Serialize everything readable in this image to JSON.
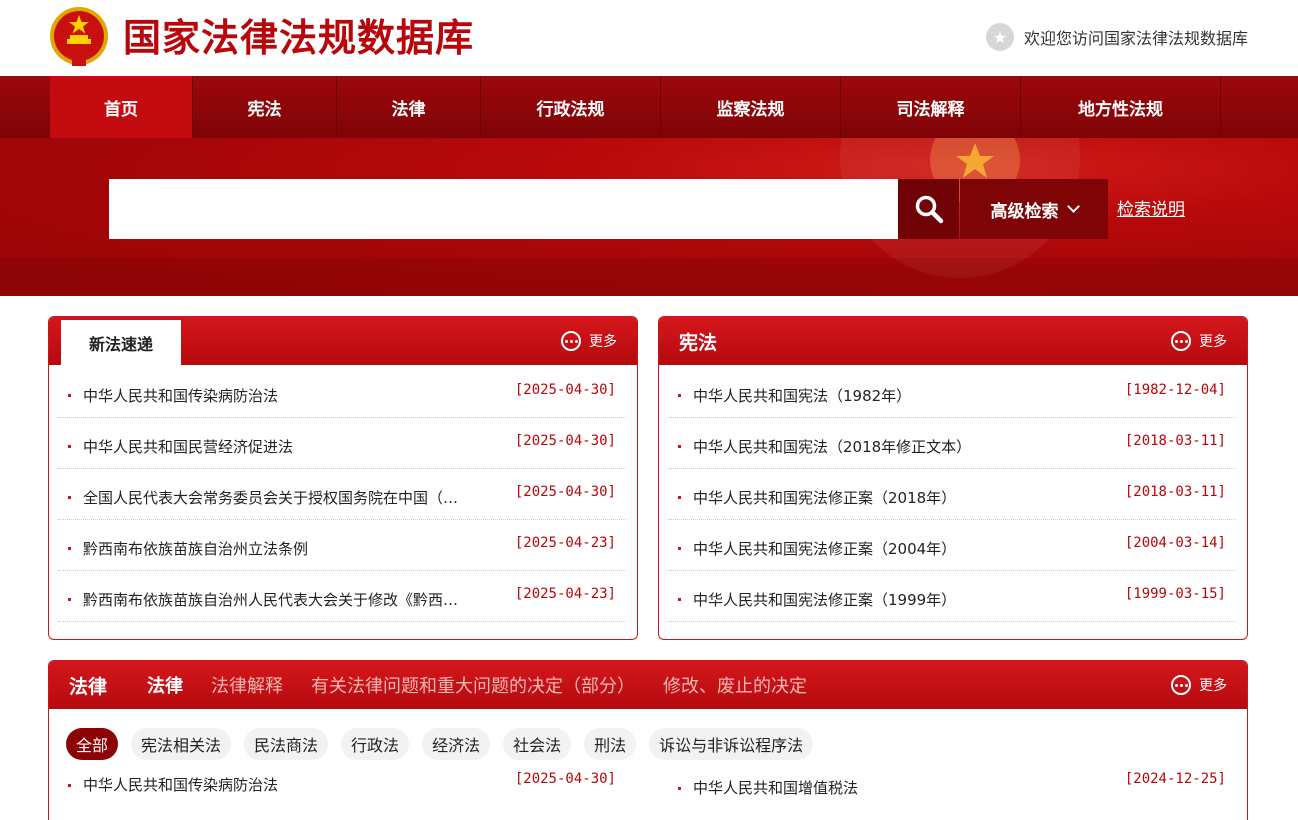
{
  "header": {
    "site_title": "国家法律法规数据库",
    "welcome": "欢迎您访问国家法律法规数据库",
    "star_icon": "star-icon",
    "emblem_icon": "national-emblem-icon"
  },
  "nav": {
    "items": [
      {
        "label": "首页",
        "active": true
      },
      {
        "label": "宪法"
      },
      {
        "label": "法律"
      },
      {
        "label": "行政法规"
      },
      {
        "label": "监察法规"
      },
      {
        "label": "司法解释"
      },
      {
        "label": "地方性法规"
      }
    ]
  },
  "search": {
    "placeholder": "",
    "search_icon": "search-icon",
    "advanced_label": "高级检索",
    "help_label": "检索说明"
  },
  "new_laws": {
    "tab": "新法速递",
    "more": "更多",
    "items": [
      {
        "title": "中华人民共和国传染病防治法",
        "date": "[2025-04-30]"
      },
      {
        "title": "中华人民共和国民营经济促进法",
        "date": "[2025-04-30]"
      },
      {
        "title": "全国人民代表大会常务委员会关于授权国务院在中国（…",
        "date": "[2025-04-30]"
      },
      {
        "title": "黔西南布依族苗族自治州立法条例",
        "date": "[2025-04-23]"
      },
      {
        "title": "黔西南布依族苗族自治州人民代表大会关于修改《黔西…",
        "date": "[2025-04-23]"
      }
    ]
  },
  "constitution": {
    "title": "宪法",
    "more": "更多",
    "items": [
      {
        "title": "中华人民共和国宪法（1982年）",
        "date": "[1982-12-04]"
      },
      {
        "title": "中华人民共和国宪法（2018年修正文本）",
        "date": "[2018-03-11]"
      },
      {
        "title": "中华人民共和国宪法修正案（2018年）",
        "date": "[2018-03-11]"
      },
      {
        "title": "中华人民共和国宪法修正案（2004年）",
        "date": "[2004-03-14]"
      },
      {
        "title": "中华人民共和国宪法修正案（1999年）",
        "date": "[1999-03-15]"
      }
    ]
  },
  "laws": {
    "title": "法律",
    "more": "更多",
    "tabs": [
      {
        "label": "法律",
        "active": true
      },
      {
        "label": "法律解释"
      },
      {
        "label": "有关法律问题和重大问题的决定（部分）"
      },
      {
        "label": "修改、废止的决定"
      }
    ],
    "chips": [
      {
        "label": "全部",
        "active": true
      },
      {
        "label": "宪法相关法"
      },
      {
        "label": "民法商法"
      },
      {
        "label": "行政法"
      },
      {
        "label": "经济法"
      },
      {
        "label": "社会法"
      },
      {
        "label": "刑法"
      },
      {
        "label": "诉讼与非诉讼程序法"
      }
    ],
    "left_item": {
      "title": "中华人民共和国传染病防治法",
      "date": "[2025-04-30]"
    },
    "right_item": {
      "title": "中华人民共和国增值税法",
      "date": "[2024-12-25]"
    }
  }
}
